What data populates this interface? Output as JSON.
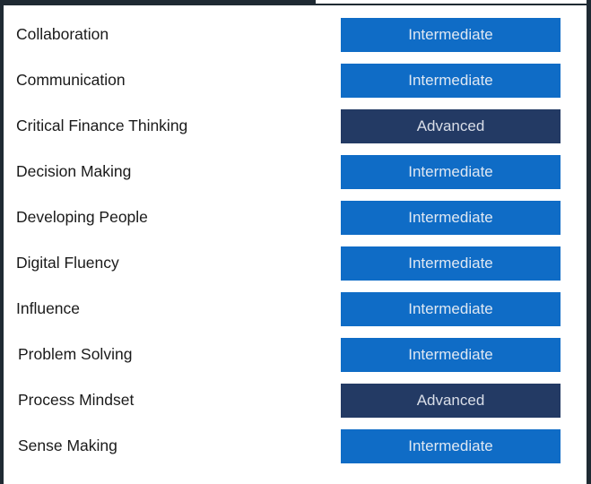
{
  "skills": [
    {
      "name": "Collaboration",
      "level": "Intermediate",
      "level_class": "intermediate"
    },
    {
      "name": "Communication",
      "level": "Intermediate",
      "level_class": "intermediate"
    },
    {
      "name": "Critical Finance Thinking",
      "level": "Advanced",
      "level_class": "advanced"
    },
    {
      "name": "Decision Making",
      "level": "Intermediate",
      "level_class": "intermediate"
    },
    {
      "name": "Developing People",
      "level": "Intermediate",
      "level_class": "intermediate"
    },
    {
      "name": "Digital Fluency",
      "level": "Intermediate",
      "level_class": "intermediate"
    },
    {
      "name": "Influence",
      "level": "Intermediate",
      "level_class": "intermediate"
    },
    {
      "name": "Problem Solving",
      "level": "Intermediate",
      "level_class": "intermediate"
    },
    {
      "name": "Process Mindset",
      "level": "Advanced",
      "level_class": "advanced"
    },
    {
      "name": "Sense Making",
      "level": "Intermediate",
      "level_class": "intermediate"
    }
  ],
  "colors": {
    "intermediate": "#0f6cc6",
    "advanced": "#233a64",
    "frame": "#1f2a33"
  }
}
